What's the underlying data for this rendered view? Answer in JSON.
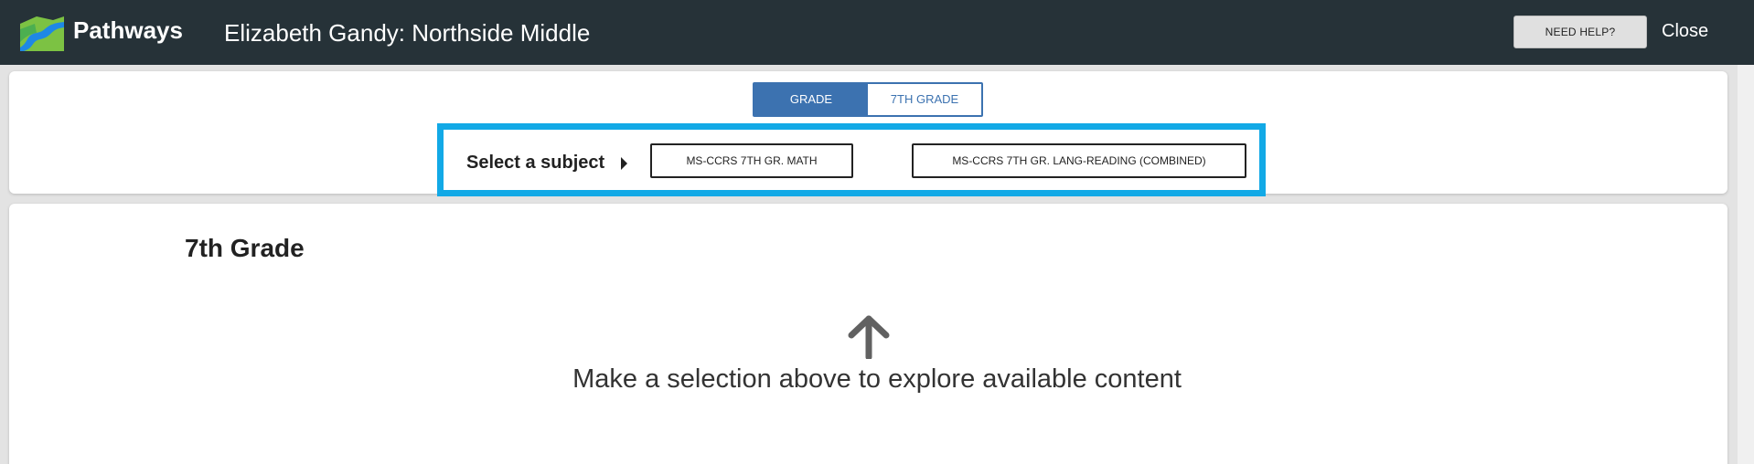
{
  "header": {
    "brand": "Pathways",
    "title": "Elizabeth Gandy: Northside Middle",
    "help_label": "NEED HELP?",
    "close_label": "Close",
    "logo_icon": "pathways-logo",
    "bg_color": "#263238"
  },
  "grade_toggle": {
    "label": "GRADE",
    "value": "7TH GRADE",
    "accent_color": "#3c72b0"
  },
  "subject_selector": {
    "label": "Select a subject",
    "caret_icon": "caret-right-icon",
    "highlight_color": "#12a9e6",
    "options": [
      "MS-CCRS 7TH GR. MATH",
      "MS-CCRS 7TH GR. LANG-READING (COMBINED)"
    ]
  },
  "main": {
    "heading": "7th Grade",
    "arrow_icon": "arrow-up-icon",
    "empty_message": "Make a selection above to explore available content"
  }
}
